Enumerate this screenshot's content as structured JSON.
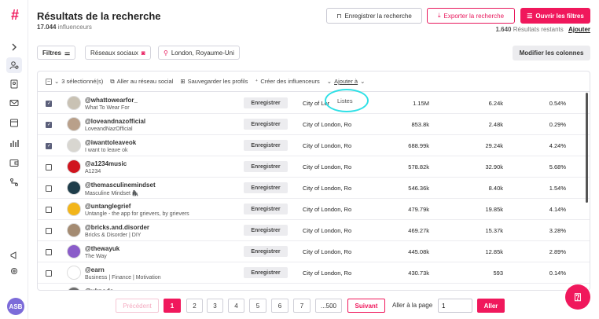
{
  "logo": "#",
  "user_initials": "ASB",
  "header": {
    "title": "Résultats de la recherche",
    "count": "17.044",
    "count_label": "influenceurs",
    "save_search": "Enregistrer la recherche",
    "export": "Exporter la recherche",
    "open_filters": "Ouvrir les filtres",
    "remaining_count": "1.640",
    "remaining_label": "Résultats restants",
    "add_link": "Ajouter"
  },
  "filters": {
    "filters_label": "Filtres",
    "social_label": "Réseaux sociaux",
    "location_label": "London, Royaume-Uni",
    "modify_columns": "Modifier les colonnes"
  },
  "toolbar": {
    "selected": "3 sélectionné(s)",
    "goto_social": "Aller au réseau social",
    "save_profiles": "Sauvegarder les profils",
    "create_influencers": "Créer des influenceurs",
    "add_to": "Ajouter à",
    "dropdown_option": "Listes"
  },
  "save_btn_label": "Enregistrer",
  "rows": [
    {
      "handle": "@whattowearfor_",
      "bio": "What To Wear For",
      "loc": "City of Lor",
      "aud": "1.15M",
      "eng": "6.24k",
      "rate": "0.54%",
      "checked": true,
      "color": "#c9c2b4"
    },
    {
      "handle": "@loveandnazofficial",
      "bio": "LoveandNazOfficial",
      "loc": "City of London, Ro",
      "aud": "853.8k",
      "eng": "2.48k",
      "rate": "0.29%",
      "checked": true,
      "color": "#b9a08a"
    },
    {
      "handle": "@iwanttoleaveok",
      "bio": "I want to leave ok",
      "loc": "City of London, Ro",
      "aud": "688.99k",
      "eng": "29.24k",
      "rate": "4.24%",
      "checked": true,
      "color": "#d8d6d0"
    },
    {
      "handle": "@a1234music",
      "bio": "A1234",
      "loc": "City of London, Ro",
      "aud": "578.82k",
      "eng": "32.90k",
      "rate": "5.68%",
      "checked": false,
      "color": "#d0141e"
    },
    {
      "handle": "@themasculinemindset",
      "bio": "Masculine Mindset 🦍",
      "loc": "City of London, Ro",
      "aud": "546.36k",
      "eng": "8.40k",
      "rate": "1.54%",
      "checked": false,
      "color": "#1f3d4a"
    },
    {
      "handle": "@untanglegrief",
      "bio": "Untangle - the app for grievers, by grievers",
      "loc": "City of London, Ro",
      "aud": "479.79k",
      "eng": "19.85k",
      "rate": "4.14%",
      "checked": false,
      "color": "#f2b51a"
    },
    {
      "handle": "@bricks.and.disorder",
      "bio": "Bricks & Disorder | DIY",
      "loc": "City of London, Ro",
      "aud": "469.27k",
      "eng": "15.37k",
      "rate": "3.28%",
      "checked": false,
      "color": "#a48b72"
    },
    {
      "handle": "@thewayuk",
      "bio": "The Way",
      "loc": "City of London, Ro",
      "aud": "445.08k",
      "eng": "12.85k",
      "rate": "2.89%",
      "checked": false,
      "color": "#8a5cc9"
    },
    {
      "handle": "@earn",
      "bio": "Business | Finance | Motivation",
      "loc": "City of London, Ro",
      "aud": "430.73k",
      "eng": "593",
      "rate": "0.14%",
      "checked": false,
      "color": "#ffffff"
    },
    {
      "handle": "@ukpods",
      "bio": "",
      "loc": "",
      "aud": "",
      "eng": "",
      "rate": "",
      "checked": false,
      "color": "#6e6e6e"
    }
  ],
  "pagination": {
    "prev": "Précédent",
    "pages": [
      "1",
      "2",
      "3",
      "4",
      "5",
      "6",
      "7",
      "...500"
    ],
    "next": "Suivant",
    "goto_label": "Aller à la page",
    "goto_value": "1",
    "go": "Aller"
  }
}
